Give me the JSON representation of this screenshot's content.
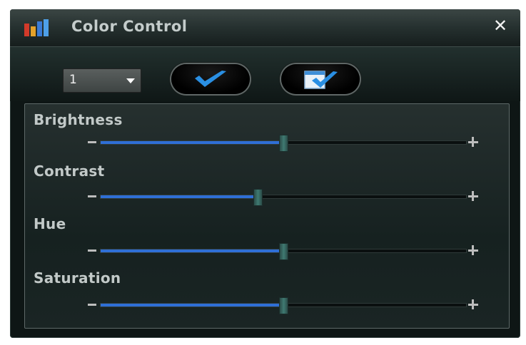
{
  "window": {
    "title": "Color Control",
    "close_icon": "close-icon"
  },
  "toolbar": {
    "channel_value": "1",
    "apply_button_icon": "checkmark-icon",
    "apply_all_button_icon": "apply-all-icon"
  },
  "sliders": [
    {
      "label": "Brightness",
      "value": 0.5
    },
    {
      "label": "Contrast",
      "value": 0.43
    },
    {
      "label": "Hue",
      "value": 0.5
    },
    {
      "label": "Saturation",
      "value": 0.5
    }
  ],
  "colors": {
    "accent_fill": "#2f6fd6",
    "thumb": "#3f7a72"
  }
}
